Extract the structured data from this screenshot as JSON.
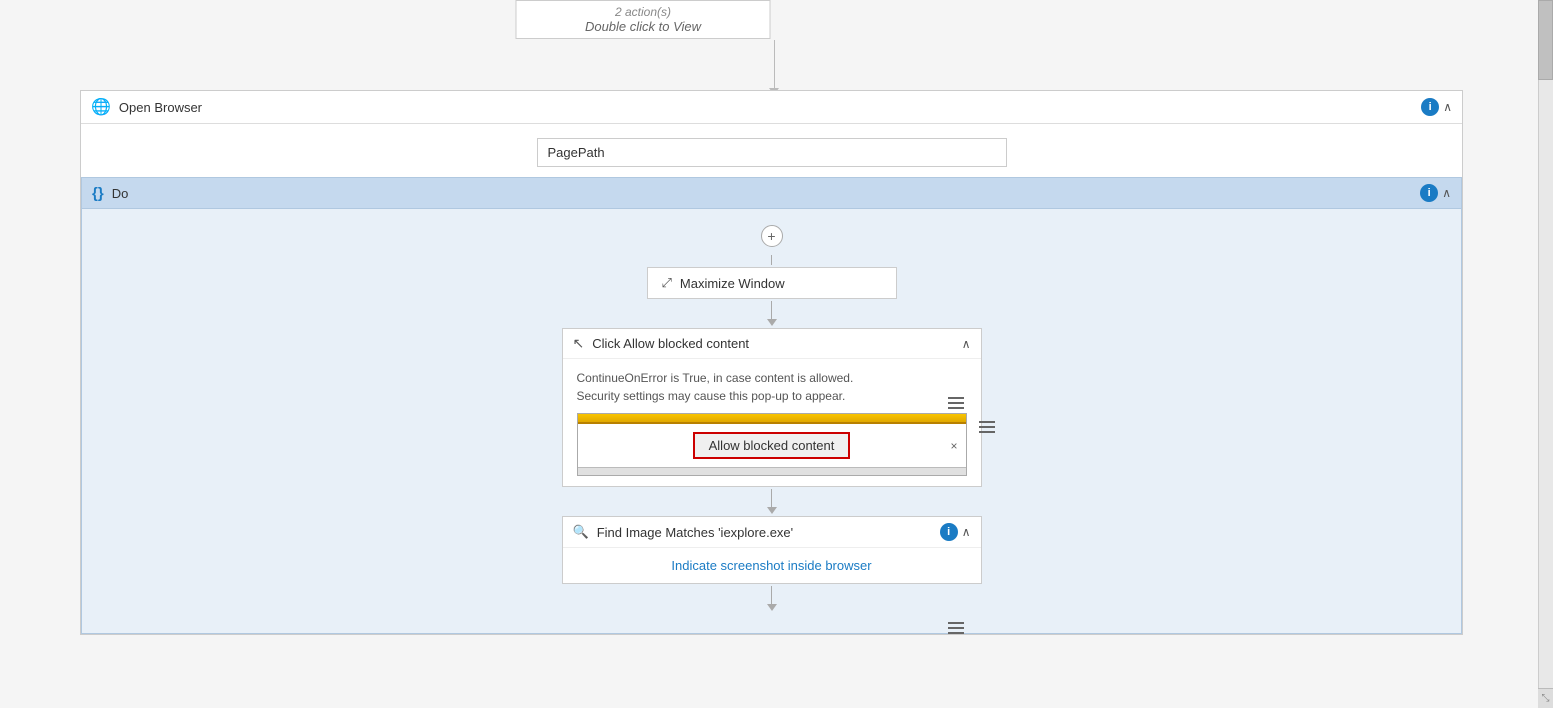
{
  "top_card": {
    "line1": "2 action(s)",
    "line2": "Double click to View"
  },
  "open_browser": {
    "title": "Open Browser",
    "page_path_placeholder": "PagePath",
    "page_path_value": "PagePath"
  },
  "do_section": {
    "title": "Do"
  },
  "maximize_window": {
    "title": "Maximize Window"
  },
  "click_allow": {
    "title": "Click Allow blocked content",
    "description_line1": "ContinueOnError is True, in case content is allowed.",
    "description_line2": "Security settings may cause this pop-up to appear.",
    "button_label": "Allow blocked content"
  },
  "find_image": {
    "title": "Find Image Matches 'iexplore.exe'",
    "link_text": "Indicate screenshot inside browser"
  },
  "icons": {
    "globe": "🌐",
    "do": "{}",
    "cursor": "↖",
    "search": "🔍",
    "maximize": "⤢",
    "info": "i",
    "menu": "≡",
    "close": "×",
    "plus": "+"
  }
}
